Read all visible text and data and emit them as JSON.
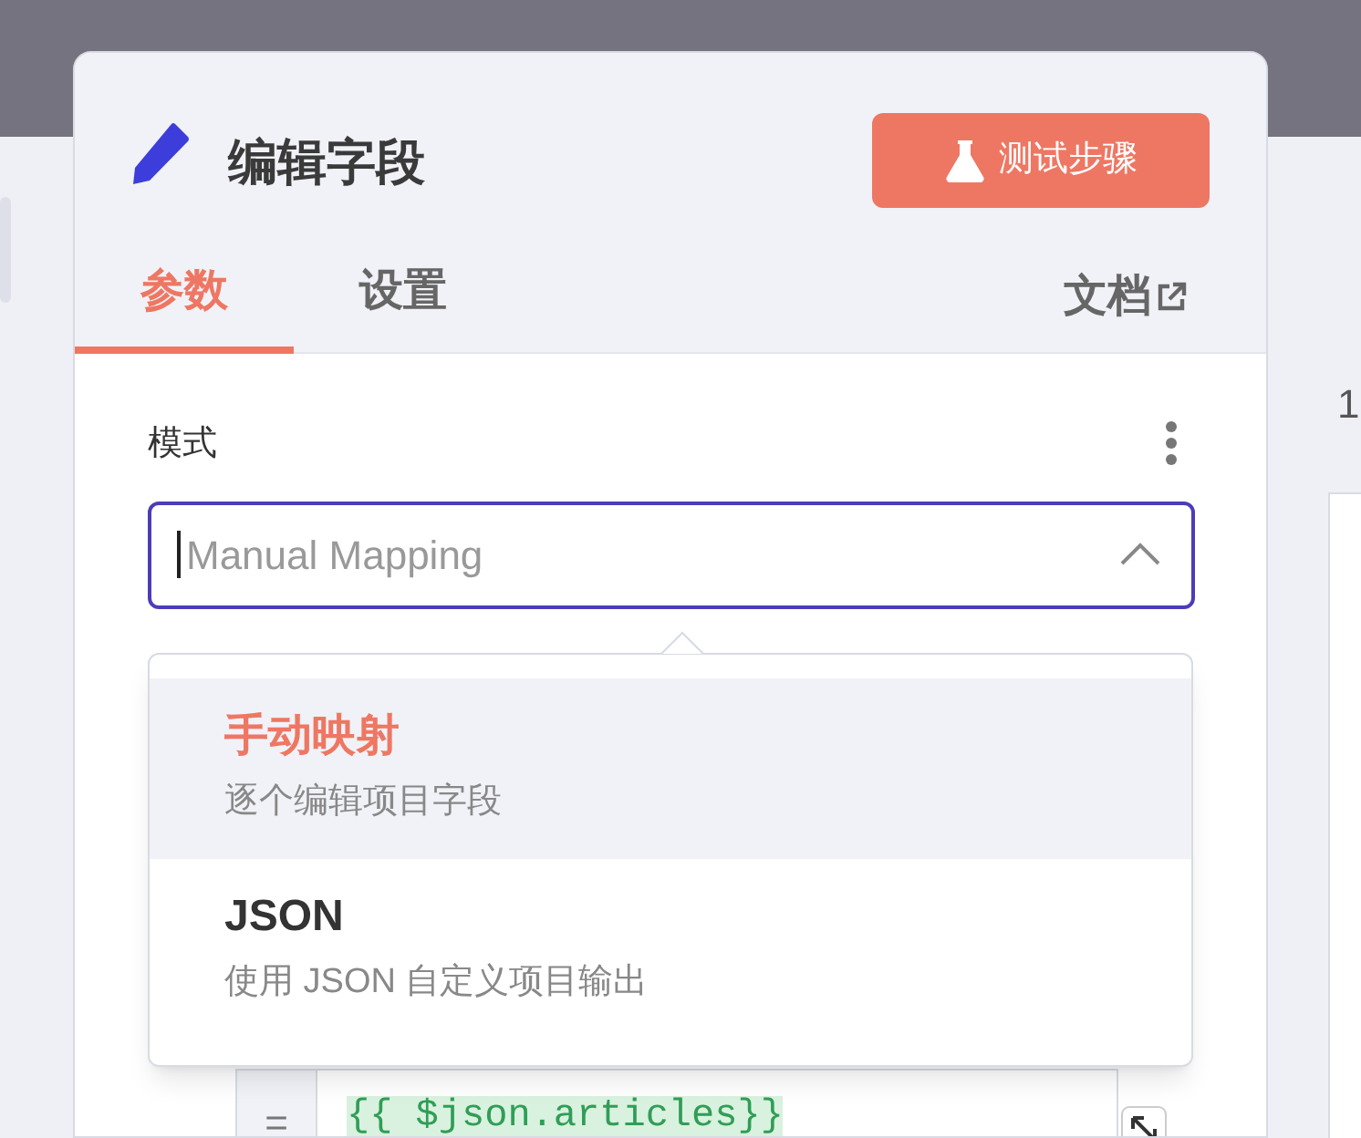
{
  "panel": {
    "title": "编辑字段",
    "test_button": "测试步骤",
    "tabs": [
      {
        "label": "参数",
        "selected": true
      },
      {
        "label": "设置",
        "selected": false
      }
    ],
    "docs_link": "文档"
  },
  "mode_field": {
    "label": "模式",
    "placeholder": "Manual Mapping",
    "expanded": true
  },
  "mode_options": [
    {
      "title": "手动映射",
      "description": "逐个编辑项目字段",
      "selected": true
    },
    {
      "title": "JSON",
      "description": "使用 JSON 自定义项目输出",
      "selected": false
    }
  ],
  "expression": {
    "prefix": "=",
    "value": "{{ $json.articles}}"
  },
  "background": {
    "row_number": "1"
  }
}
